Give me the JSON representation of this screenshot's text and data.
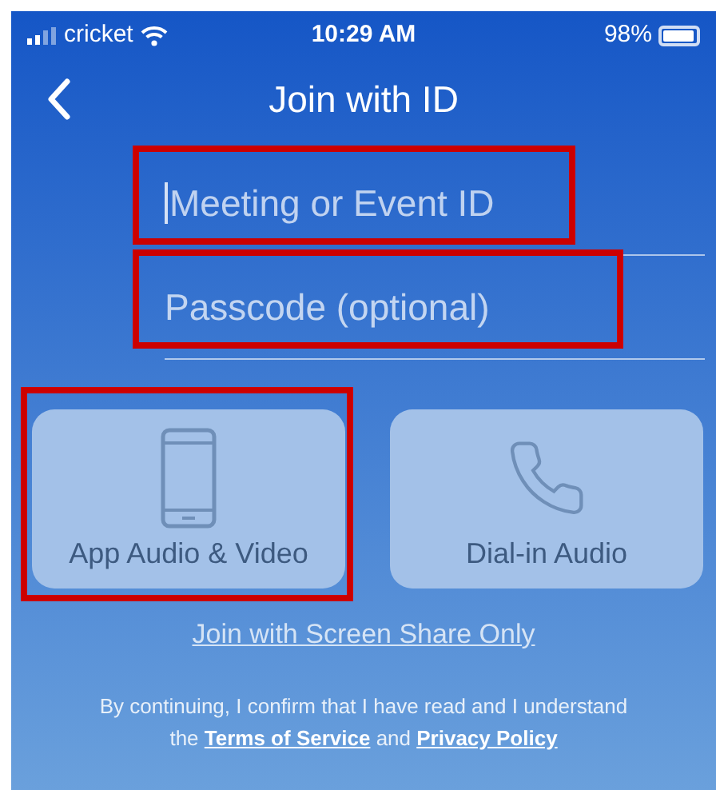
{
  "status_bar": {
    "carrier": "cricket",
    "time": "10:29 AM",
    "battery": "98%"
  },
  "header": {
    "title": "Join with ID"
  },
  "fields": [
    {
      "placeholder": "Meeting or Event ID",
      "focused": true,
      "highlighted": true
    },
    {
      "placeholder": "Passcode (optional)",
      "focused": false,
      "highlighted": true
    }
  ],
  "options": [
    {
      "kind": "phone",
      "label": "App Audio & Video",
      "highlighted": true
    },
    {
      "kind": "call",
      "label": "Dial-in Audio",
      "highlighted": false
    }
  ],
  "screen_share_link": "Join with Screen Share Only",
  "footer": [
    {
      "kind": "text",
      "text": "By continuing, I confirm that I have read and I understand the "
    },
    {
      "kind": "link",
      "text": "Terms of Service"
    },
    {
      "kind": "text",
      "text": " and "
    },
    {
      "kind": "link",
      "text": "Privacy Policy"
    }
  ]
}
